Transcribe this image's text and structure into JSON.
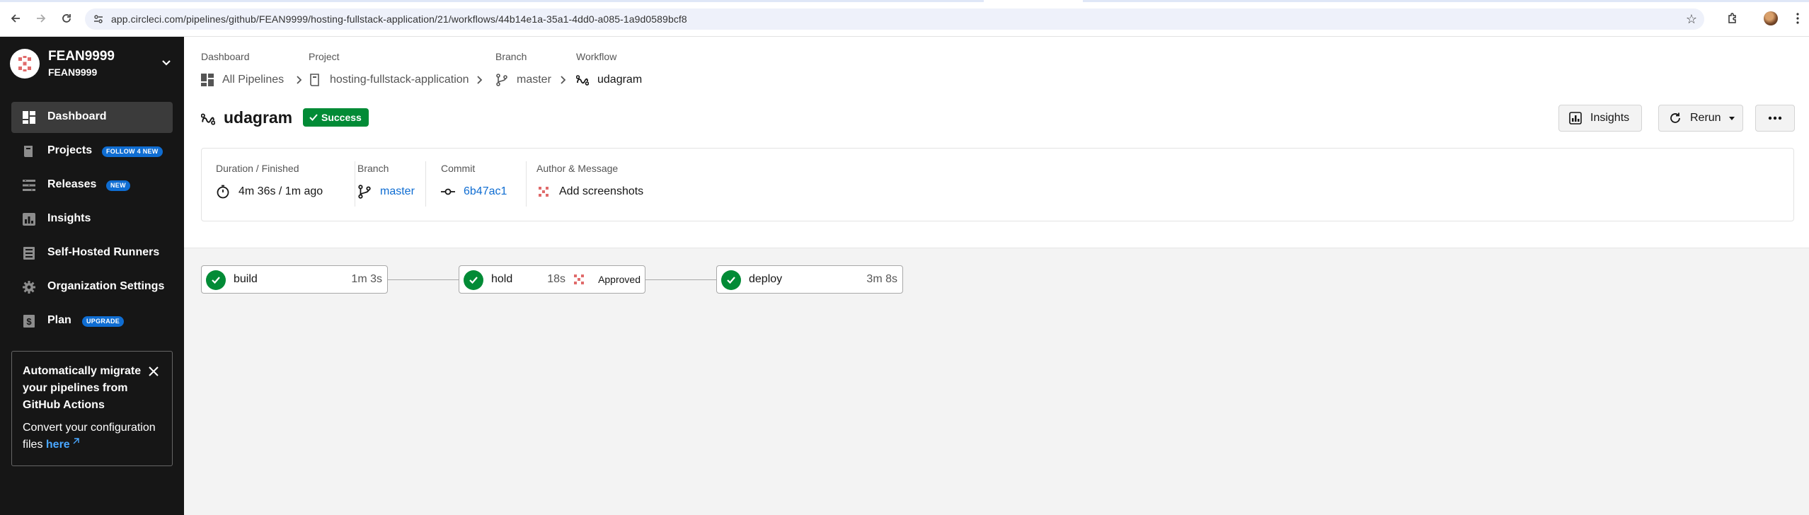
{
  "browser": {
    "url": "app.circleci.com/pipelines/github/FEAN9999/hosting-fullstack-application/21/workflows/44b14e1a-35a1-4dd0-a085-1a9d0589bcf8"
  },
  "sidebar": {
    "org_name": "FEAN9999",
    "org_sub": "FEAN9999",
    "items": [
      {
        "label": "Dashboard",
        "icon": "dashboard-icon",
        "active": true
      },
      {
        "label": "Projects",
        "icon": "projects-icon",
        "badge": "FOLLOW 4 NEW"
      },
      {
        "label": "Releases",
        "icon": "releases-icon",
        "badge": "NEW"
      },
      {
        "label": "Insights",
        "icon": "insights-icon"
      },
      {
        "label": "Self-Hosted Runners",
        "icon": "runners-icon"
      },
      {
        "label": "Organization Settings",
        "icon": "gear-icon"
      },
      {
        "label": "Plan",
        "icon": "plan-icon",
        "badge": "UPGRADE"
      }
    ],
    "promo": {
      "title": "Automatically migrate your pipelines from GitHub Actions",
      "body": "Convert your configuration files",
      "link": "here"
    }
  },
  "breadcrumbs": [
    {
      "label": "Dashboard",
      "value": "All Pipelines"
    },
    {
      "label": "Project",
      "value": "hosting-fullstack-application"
    },
    {
      "label": "Branch",
      "value": "master"
    },
    {
      "label": "Workflow",
      "value": "udagram"
    }
  ],
  "workflow": {
    "title": "udagram",
    "status": "Success",
    "status_color": "#028b36",
    "actions": {
      "insights": "Insights",
      "rerun": "Rerun"
    }
  },
  "meta": {
    "duration_label": "Duration / Finished",
    "duration_value": "4m 36s / 1m ago",
    "branch_label": "Branch",
    "branch_value": "master",
    "commit_label": "Commit",
    "commit_value": "6b47ac1",
    "author_label": "Author & Message",
    "message": "Add screenshots"
  },
  "jobs": [
    {
      "name": "build",
      "duration": "1m 3s"
    },
    {
      "name": "hold",
      "duration": "18s",
      "approval": "Approved"
    },
    {
      "name": "deploy",
      "duration": "3m 8s"
    }
  ],
  "colors": {
    "accent": "#0f6dd2",
    "success": "#028b36",
    "sidebar_bg": "#161616"
  }
}
